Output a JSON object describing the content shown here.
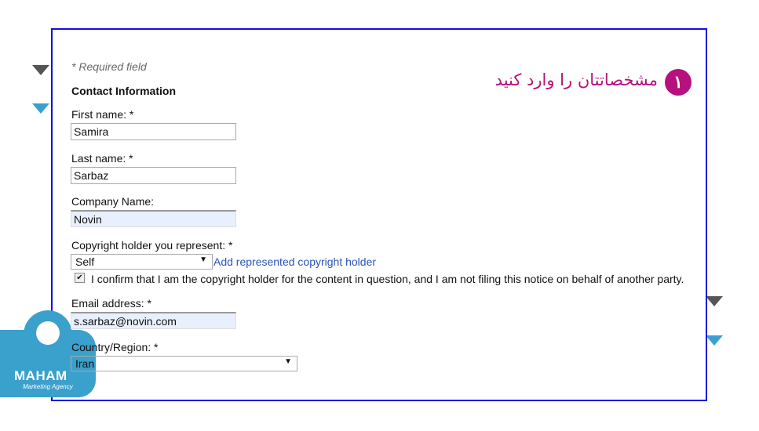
{
  "form": {
    "required_note": "* Required field",
    "section_title": "Contact Information",
    "first_name_label": "First name: *",
    "first_name": "Samira",
    "last_name_label": "Last name: *",
    "last_name": "Sarbaz",
    "company_label": "Company Name:",
    "company": "Novin",
    "holder_label": "Copyright holder you represent: *",
    "holder": "Self",
    "add_holder_link": "Add represented copyright holder",
    "confirm_text": "I confirm that I am the copyright holder for the content in question, and I am not filing this notice on behalf of another party.",
    "confirm_checked": true,
    "email_label": "Email address: *",
    "email": "s.sarbaz@novin.com",
    "country_label": "Country/Region: *",
    "country": "Iran"
  },
  "annotation": {
    "step": "١",
    "text": "مشخصاتتان را وارد کنید",
    "color": "#b5117f"
  },
  "logo": {
    "name": "MAHAM",
    "tagline": "Marketing Agency",
    "color": "#3aa0cc"
  },
  "link_color": "#2a55b8",
  "frame_color": "#1010e0"
}
